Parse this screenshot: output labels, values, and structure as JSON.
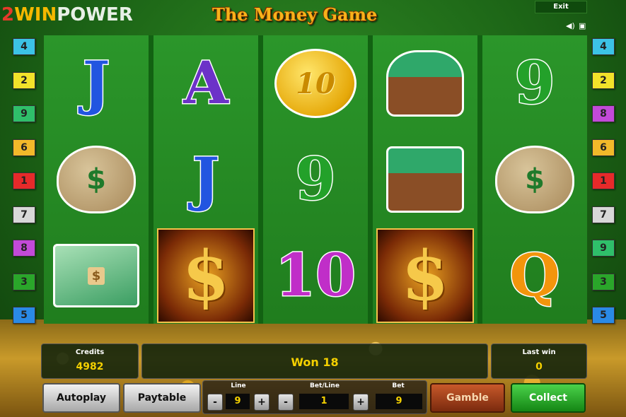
{
  "header": {
    "logo": {
      "part1": "2",
      "part2": "WIN",
      "part3": "POWER"
    },
    "game_title": "The Money Game",
    "exit_label": "Exit",
    "sound_icon": "speaker-icon",
    "fullscreen_icon": "fullscreen-icon"
  },
  "paylines": {
    "left": [
      {
        "label": "4",
        "color": "#3cc3e6"
      },
      {
        "label": "2",
        "color": "#f2e22a"
      },
      {
        "label": "9",
        "color": "#2fbf6a"
      },
      {
        "label": "6",
        "color": "#f2b92a"
      },
      {
        "label": "1",
        "color": "#e62a2a"
      },
      {
        "label": "7",
        "color": "#d8d8d8"
      },
      {
        "label": "8",
        "color": "#c24ad8"
      },
      {
        "label": "3",
        "color": "#2aa62a"
      },
      {
        "label": "5",
        "color": "#2a8ae6"
      }
    ],
    "right": [
      {
        "label": "4",
        "color": "#3cc3e6"
      },
      {
        "label": "2",
        "color": "#f2e22a"
      },
      {
        "label": "8",
        "color": "#c24ad8"
      },
      {
        "label": "6",
        "color": "#f2b92a"
      },
      {
        "label": "1",
        "color": "#e62a2a"
      },
      {
        "label": "7",
        "color": "#d8d8d8"
      },
      {
        "label": "9",
        "color": "#2fbf6a"
      },
      {
        "label": "3",
        "color": "#2aa62a"
      },
      {
        "label": "5",
        "color": "#2a8ae6"
      }
    ]
  },
  "reels": [
    {
      "symbols": [
        {
          "type": "letter",
          "text": "J",
          "style": "blue"
        },
        {
          "type": "bag",
          "text": "$"
        },
        {
          "type": "stack",
          "text": "$"
        }
      ]
    },
    {
      "symbols": [
        {
          "type": "letter",
          "text": "A",
          "style": "purple"
        },
        {
          "type": "letter",
          "text": "J",
          "style": "blue"
        },
        {
          "type": "dollar",
          "text": "$"
        }
      ]
    },
    {
      "symbols": [
        {
          "type": "coin",
          "text": "10"
        },
        {
          "type": "letter",
          "text": "9",
          "style": "green9"
        },
        {
          "type": "letter",
          "text": "10",
          "style": "magenta"
        }
      ]
    },
    {
      "symbols": [
        {
          "type": "wallet-bag",
          "text": ""
        },
        {
          "type": "wallet",
          "text": ""
        },
        {
          "type": "dollar",
          "text": "$"
        }
      ]
    },
    {
      "symbols": [
        {
          "type": "letter",
          "text": "9",
          "style": "green9"
        },
        {
          "type": "bag",
          "text": "$"
        },
        {
          "type": "letter",
          "text": "Q",
          "style": "orange"
        }
      ]
    }
  ],
  "info": {
    "credits_label": "Credits",
    "credits_value": "4982",
    "message": "Won 18",
    "last_win_label": "Last win",
    "last_win_value": "0"
  },
  "controls": {
    "autoplay": "Autoplay",
    "paytable": "Paytable",
    "line_label": "Line",
    "line_value": "9",
    "betline_label": "Bet/Line",
    "betline_value": "1",
    "bet_label": "Bet",
    "bet_value": "9",
    "minus": "-",
    "plus": "+",
    "gamble": "Gamble",
    "collect": "Collect"
  }
}
